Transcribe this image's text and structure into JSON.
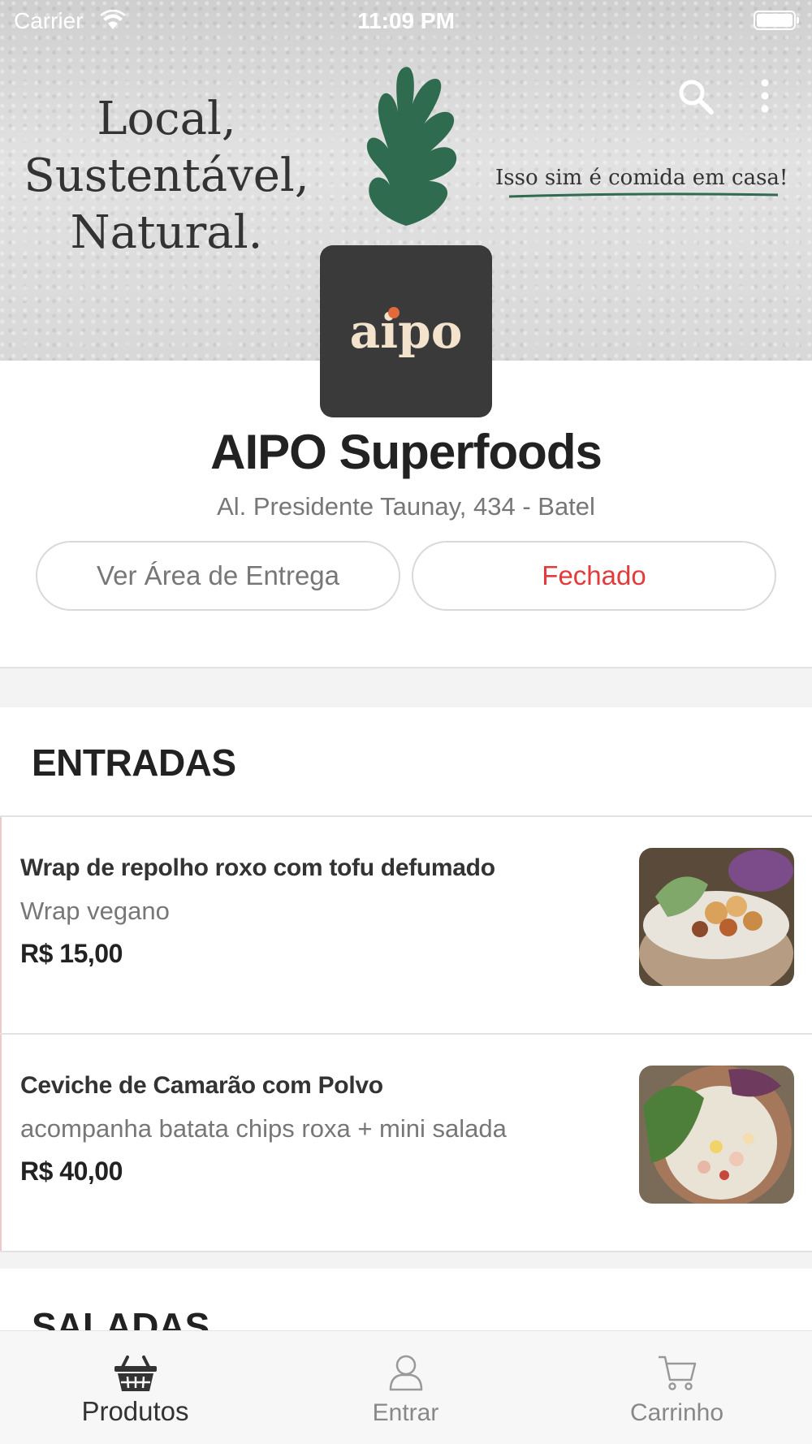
{
  "status_bar": {
    "carrier": "Carrier",
    "time": "11:09 PM"
  },
  "banner": {
    "slogan_lines": [
      "Local,",
      "Sustentável,",
      "Natural."
    ],
    "tagline": "Isso sim é comida em casa!",
    "accent_color": "#2f6b4f"
  },
  "header": {
    "search_icon": "search-icon",
    "more_icon": "more-vertical-icon"
  },
  "store": {
    "logo_text": "aipo",
    "name": "AIPO Superfoods",
    "address": "Al. Presidente Taunay, 434 - Batel",
    "delivery_area_label": "Ver Área de Entrega",
    "status_label": "Fechado",
    "status_color": "#e33b3b"
  },
  "sections": [
    {
      "title": "ENTRADAS",
      "products": [
        {
          "name": "Wrap de repolho roxo com tofu defumado",
          "description": "Wrap vegano",
          "price": "R$ 15,00"
        },
        {
          "name": "Ceviche de Camarão com Polvo",
          "description": "acompanha batata chips roxa + mini salada",
          "price": "R$ 40,00"
        }
      ]
    },
    {
      "title": "SALADAS",
      "products": []
    }
  ],
  "tab_bar": {
    "tabs": [
      {
        "label": "Produtos",
        "icon": "basket-icon",
        "active": true
      },
      {
        "label": "Entrar",
        "icon": "user-icon",
        "active": false
      },
      {
        "label": "Carrinho",
        "icon": "cart-icon",
        "active": false
      }
    ]
  }
}
